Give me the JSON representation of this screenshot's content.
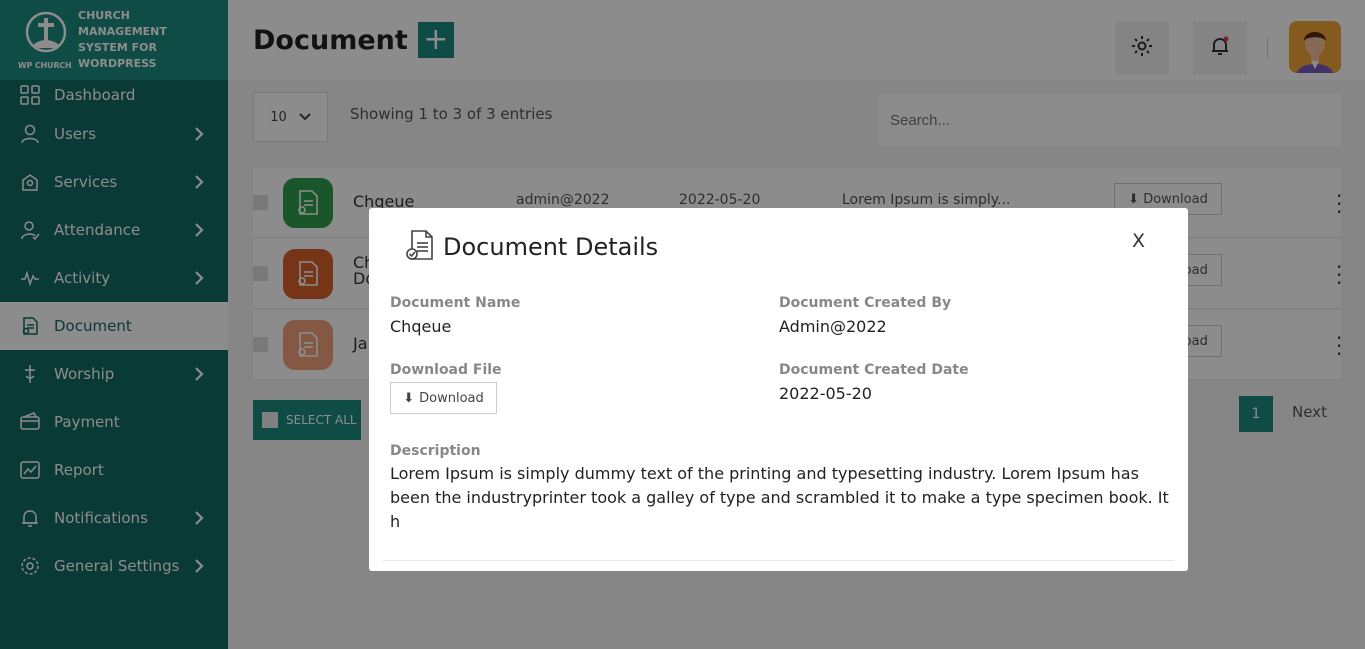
{
  "brand": {
    "logo_text": "WP CHURCH",
    "title_lines": [
      "CHURCH MANAGEMENT",
      "SYSTEM FOR",
      "WORDPRESS"
    ]
  },
  "sidebar": {
    "items": [
      {
        "label": "Dashboard",
        "icon": "grid-icon",
        "chevron": false
      },
      {
        "label": "Users",
        "icon": "user-icon",
        "chevron": true
      },
      {
        "label": "Services",
        "icon": "services-icon",
        "chevron": true
      },
      {
        "label": "Attendance",
        "icon": "attendance-icon",
        "chevron": true
      },
      {
        "label": "Activity",
        "icon": "activity-icon",
        "chevron": true
      },
      {
        "label": "Document",
        "icon": "document-icon",
        "chevron": false,
        "active": true
      },
      {
        "label": "Worship",
        "icon": "worship-icon",
        "chevron": true
      },
      {
        "label": "Payment",
        "icon": "payment-icon",
        "chevron": false
      },
      {
        "label": "Report",
        "icon": "report-icon",
        "chevron": false
      },
      {
        "label": "Notifications",
        "icon": "bell-icon",
        "chevron": true
      },
      {
        "label": "General Settings",
        "icon": "gear-icon",
        "chevron": true
      }
    ]
  },
  "header": {
    "title": "Document",
    "add_label": "+"
  },
  "toolbar": {
    "entries_value": "10",
    "showing_text": "Showing 1 to 3 of 3 entries",
    "search_placeholder": "Search..."
  },
  "rows": [
    {
      "name": "Chqeue",
      "created_by": "admin@2022",
      "date": "2022-05-20",
      "desc": "Lorem Ipsum is simply...",
      "download": "Download",
      "color": "#2e9e4f"
    },
    {
      "name": "Ch",
      "name2": "Do",
      "download": "Download",
      "color": "#d9612a"
    },
    {
      "name": "Ja",
      "download": "Download",
      "color": "#f0a07a"
    }
  ],
  "footer": {
    "select_all": "SELECT ALL",
    "previous": "ious",
    "page": "1",
    "next": "Next"
  },
  "modal": {
    "title": "Document Details",
    "close": "X",
    "name_label": "Document Name",
    "name_value": "Chqeue",
    "created_by_label": "Document Created By",
    "created_by_value": "Admin@2022",
    "download_label": "Download File",
    "download_btn": "Download",
    "created_date_label": "Document Created Date",
    "created_date_value": "2022-05-20",
    "description_label": "Description",
    "description_value": "Lorem Ipsum is simply dummy text of the printing and typesetting industry. Lorem Ipsum has been the industryprinter took a galley of type and scrambled it to make a type specimen book. It h"
  },
  "colors": {
    "sidebar": "#136a62",
    "brand": "#1a8a7e",
    "accent": "#1a8a7e"
  }
}
